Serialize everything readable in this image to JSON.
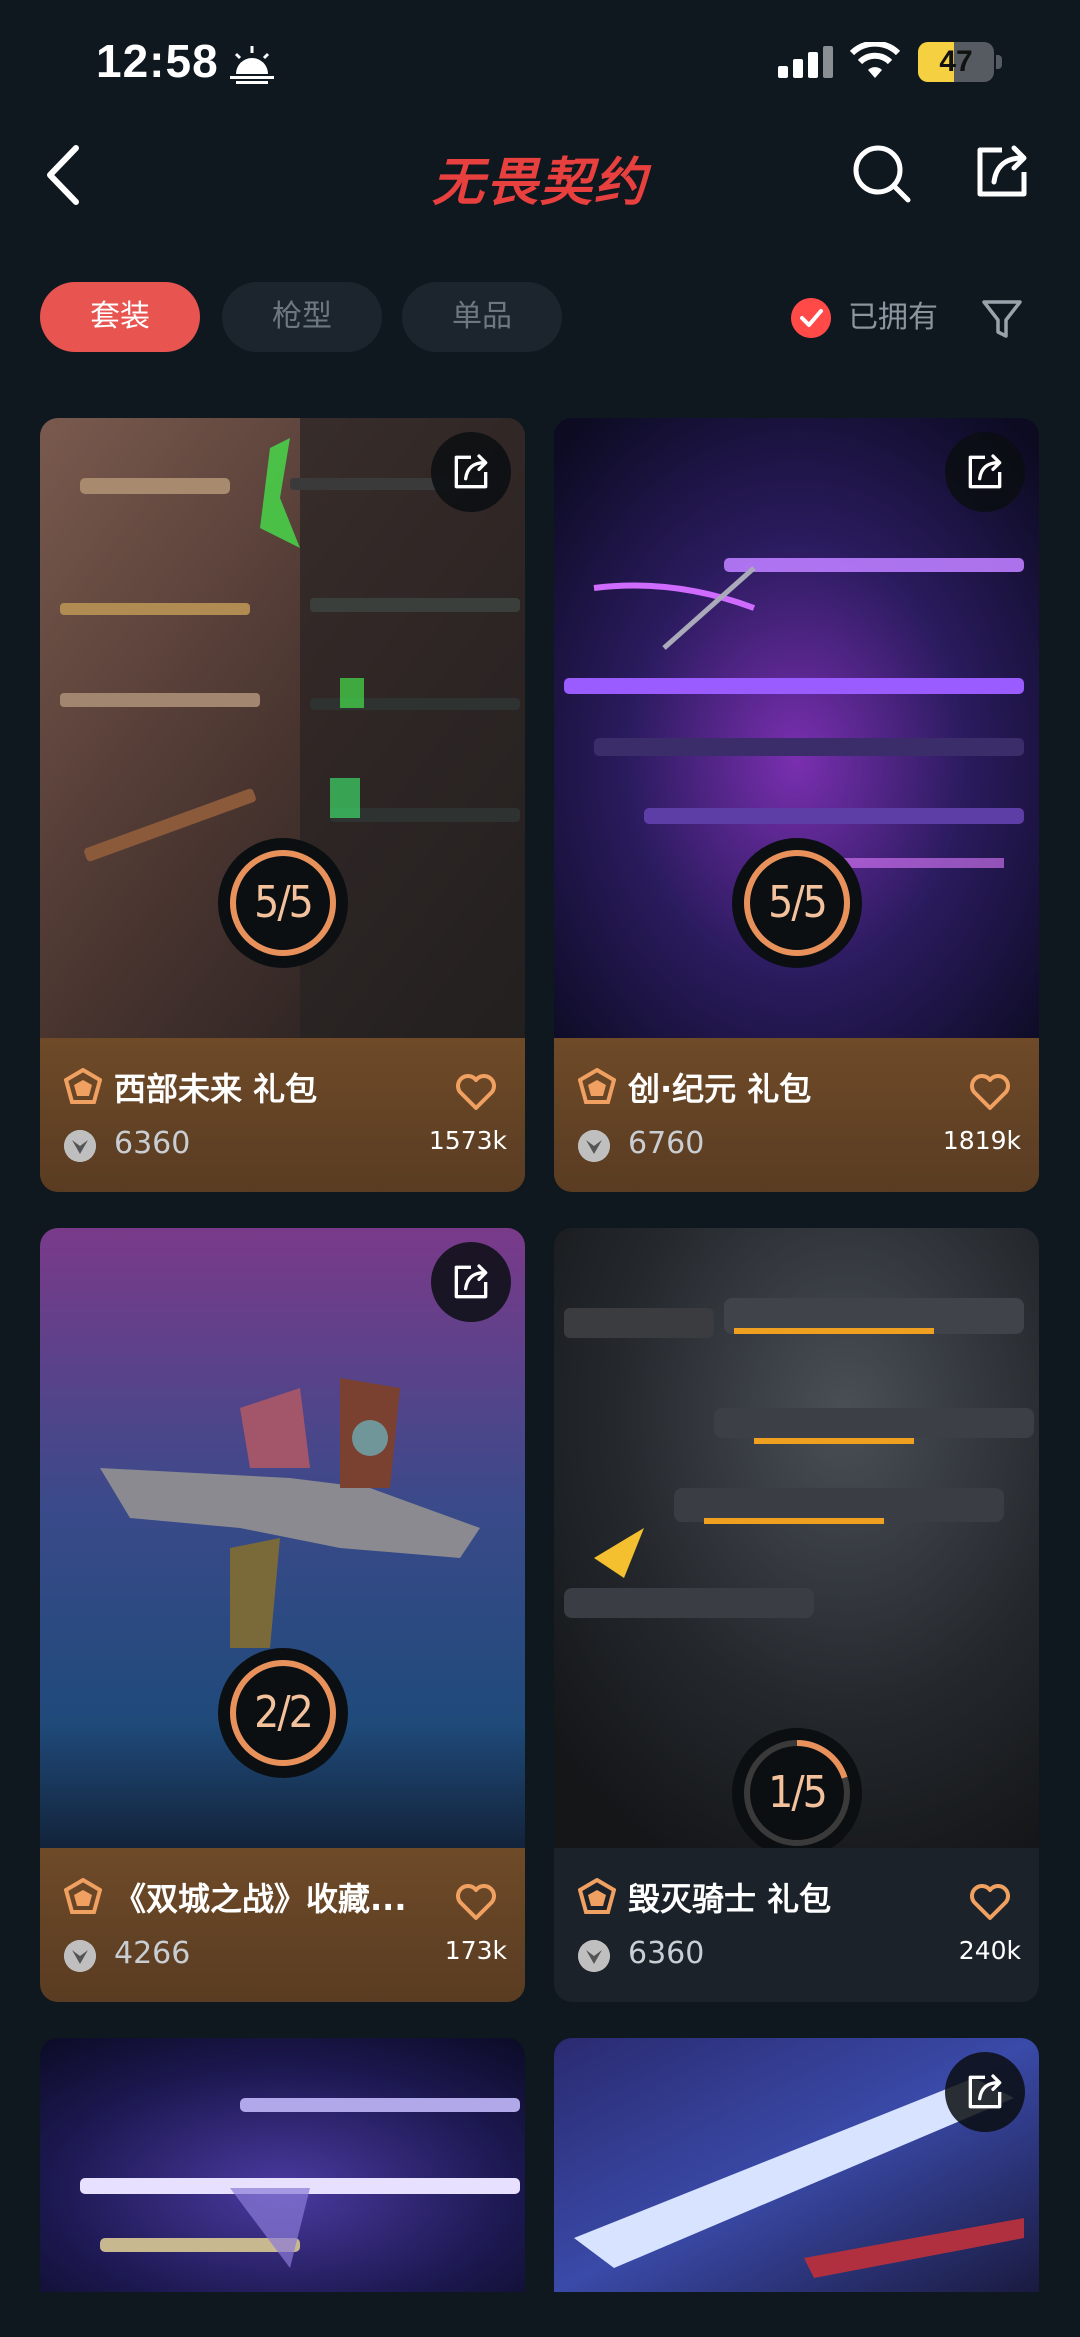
{
  "status_bar": {
    "time": "12:58",
    "battery": "47",
    "battery_level": 0.47
  },
  "header": {
    "title": "无畏契约"
  },
  "filters": {
    "tabs": [
      {
        "label": "套装",
        "active": true
      },
      {
        "label": "枪型",
        "active": false
      },
      {
        "label": "单品",
        "active": false
      }
    ],
    "owned_label": "已拥有"
  },
  "cards": [
    {
      "name": "西部未来 礼包",
      "price": "6360",
      "likes": "1573k",
      "progress": "5/5",
      "progress_fraction": 1.0
    },
    {
      "name": "创·纪元 礼包",
      "price": "6760",
      "likes": "1819k",
      "progress": "5/5",
      "progress_fraction": 1.0
    },
    {
      "name": "《双城之战》收藏...",
      "price": "4266",
      "likes": "173k",
      "progress": "2/2",
      "progress_fraction": 1.0
    },
    {
      "name": "毁灭骑士 礼包",
      "price": "6360",
      "likes": "240k",
      "progress": "1/5",
      "progress_fraction": 0.2
    }
  ],
  "colors": {
    "accent": "#e85450",
    "title": "#e8403f",
    "card_info": "#6e4a28",
    "progress_ring": "#e8915a",
    "background": "#0f171f"
  }
}
